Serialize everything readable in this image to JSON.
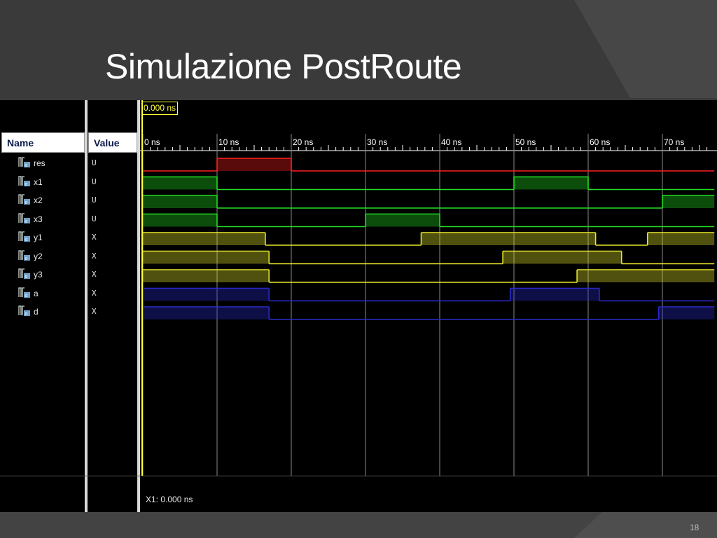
{
  "slide": {
    "title": "Simulazione PostRoute",
    "page_number": "18"
  },
  "sim": {
    "cursor_label": "0.000 ns",
    "footer_cursor": "X1: 0.000 ns",
    "headers": {
      "name": "Name",
      "value": "Value"
    },
    "time_ticks": [
      "0 ns",
      "10 ns",
      "20 ns",
      "30 ns",
      "40 ns",
      "50 ns",
      "60 ns",
      "70 ns"
    ],
    "signals": [
      {
        "name": "res",
        "value": "U",
        "color": "#ff2020",
        "segments": [
          {
            "from": 0,
            "to": 10,
            "state": "low"
          },
          {
            "from": 10,
            "to": 20,
            "state": "high"
          },
          {
            "from": 20,
            "to": 77,
            "state": "low"
          }
        ]
      },
      {
        "name": "x1",
        "value": "U",
        "color": "#22dd22",
        "segments": [
          {
            "from": 0,
            "to": 10,
            "state": "high"
          },
          {
            "from": 10,
            "to": 50,
            "state": "low"
          },
          {
            "from": 50,
            "to": 60,
            "state": "high"
          },
          {
            "from": 60,
            "to": 77,
            "state": "low"
          }
        ]
      },
      {
        "name": "x2",
        "value": "U",
        "color": "#22dd22",
        "segments": [
          {
            "from": 0,
            "to": 10,
            "state": "high"
          },
          {
            "from": 10,
            "to": 70,
            "state": "low"
          },
          {
            "from": 70,
            "to": 77,
            "state": "high"
          }
        ]
      },
      {
        "name": "x3",
        "value": "U",
        "color": "#22dd22",
        "segments": [
          {
            "from": 0,
            "to": 10,
            "state": "high"
          },
          {
            "from": 10,
            "to": 30,
            "state": "low"
          },
          {
            "from": 30,
            "to": 40,
            "state": "high"
          },
          {
            "from": 40,
            "to": 77,
            "state": "low"
          }
        ]
      },
      {
        "name": "y1",
        "value": "X",
        "color": "#e6e62a",
        "segments": [
          {
            "from": 0,
            "to": 16.5,
            "state": "high"
          },
          {
            "from": 16.5,
            "to": 37.5,
            "state": "low"
          },
          {
            "from": 37.5,
            "to": 61,
            "state": "high"
          },
          {
            "from": 61,
            "to": 68,
            "state": "low"
          },
          {
            "from": 68,
            "to": 77,
            "state": "high"
          }
        ]
      },
      {
        "name": "y2",
        "value": "X",
        "color": "#e6e62a",
        "segments": [
          {
            "from": 0,
            "to": 17,
            "state": "high"
          },
          {
            "from": 17,
            "to": 48.5,
            "state": "low"
          },
          {
            "from": 48.5,
            "to": 64.5,
            "state": "high"
          },
          {
            "from": 64.5,
            "to": 77,
            "state": "low"
          }
        ]
      },
      {
        "name": "y3",
        "value": "X",
        "color": "#e6e62a",
        "segments": [
          {
            "from": 0,
            "to": 17,
            "state": "high"
          },
          {
            "from": 17,
            "to": 58.5,
            "state": "low"
          },
          {
            "from": 58.5,
            "to": 77,
            "state": "high"
          }
        ]
      },
      {
        "name": "a",
        "value": "X",
        "color": "#2a2acc",
        "segments": [
          {
            "from": 0,
            "to": 17,
            "state": "high"
          },
          {
            "from": 17,
            "to": 49.5,
            "state": "low"
          },
          {
            "from": 49.5,
            "to": 61.5,
            "state": "high"
          },
          {
            "from": 61.5,
            "to": 77,
            "state": "low"
          }
        ]
      },
      {
        "name": "d",
        "value": "X",
        "color": "#2a2acc",
        "segments": [
          {
            "from": 0,
            "to": 17,
            "state": "high"
          },
          {
            "from": 17,
            "to": 69.5,
            "state": "low"
          },
          {
            "from": 69.5,
            "to": 77,
            "state": "high"
          }
        ]
      }
    ]
  }
}
